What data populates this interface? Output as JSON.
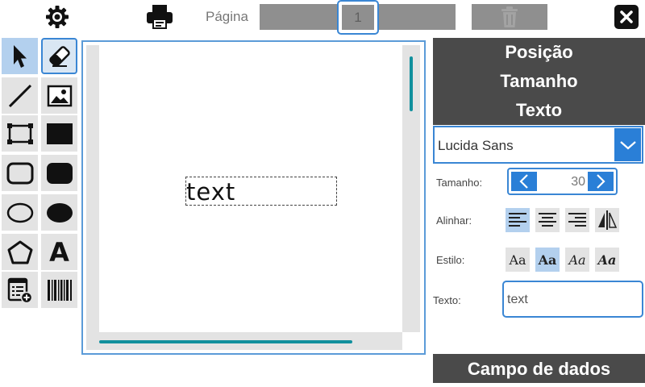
{
  "toolbar": {
    "page_label": "Página",
    "page_number": "1",
    "icons": [
      "gear-icon",
      "printer-icon",
      "trash-icon",
      "close-icon"
    ]
  },
  "tools": [
    {
      "name": "select-tool",
      "icon": "arrow-pointer-icon",
      "selected": true
    },
    {
      "name": "eraser-tool",
      "icon": "eraser-icon",
      "outlined": true
    },
    {
      "name": "line-tool",
      "icon": "line-icon"
    },
    {
      "name": "image-tool",
      "icon": "image-icon"
    },
    {
      "name": "rectangle-outline-tool",
      "icon": "rectangle-outline-icon"
    },
    {
      "name": "rectangle-filled-tool",
      "icon": "rectangle-filled-icon"
    },
    {
      "name": "rounded-rect-outline-tool",
      "icon": "rounded-rect-outline-icon"
    },
    {
      "name": "rounded-rect-filled-tool",
      "icon": "rounded-rect-filled-icon"
    },
    {
      "name": "ellipse-outline-tool",
      "icon": "ellipse-outline-icon"
    },
    {
      "name": "ellipse-filled-tool",
      "icon": "ellipse-filled-icon"
    },
    {
      "name": "polygon-tool",
      "icon": "pentagon-icon"
    },
    {
      "name": "text-tool",
      "icon": "text-a-icon",
      "label": "A"
    },
    {
      "name": "add-field-tool",
      "icon": "list-add-icon"
    },
    {
      "name": "barcode-tool",
      "icon": "barcode-icon"
    }
  ],
  "canvas": {
    "text_object": "text"
  },
  "properties": {
    "sections": [
      "Posição",
      "Tamanho",
      "Texto"
    ],
    "font": "Lucida Sans",
    "size_label": "Tamanho:",
    "size_value": "30",
    "align_label": "Alinhar:",
    "align_options": [
      "align-left-icon",
      "align-center-icon",
      "align-right-icon",
      "mirror-icon"
    ],
    "align_active": 0,
    "style_label": "Estilo:",
    "style_options": [
      "Aa",
      "Aa",
      "Aa",
      "Aa"
    ],
    "style_active": 1,
    "text_label": "Texto:",
    "text_value": "text",
    "data_field": "Campo de dados"
  },
  "colors": {
    "accent": "#3a86d4",
    "button_blue": "#2a7fd7",
    "header_dark": "#4a4a4a",
    "scroll_teal": "#11909d",
    "tool_bg": "#e3e3e3",
    "tool_selected": "#b3d0ee"
  }
}
